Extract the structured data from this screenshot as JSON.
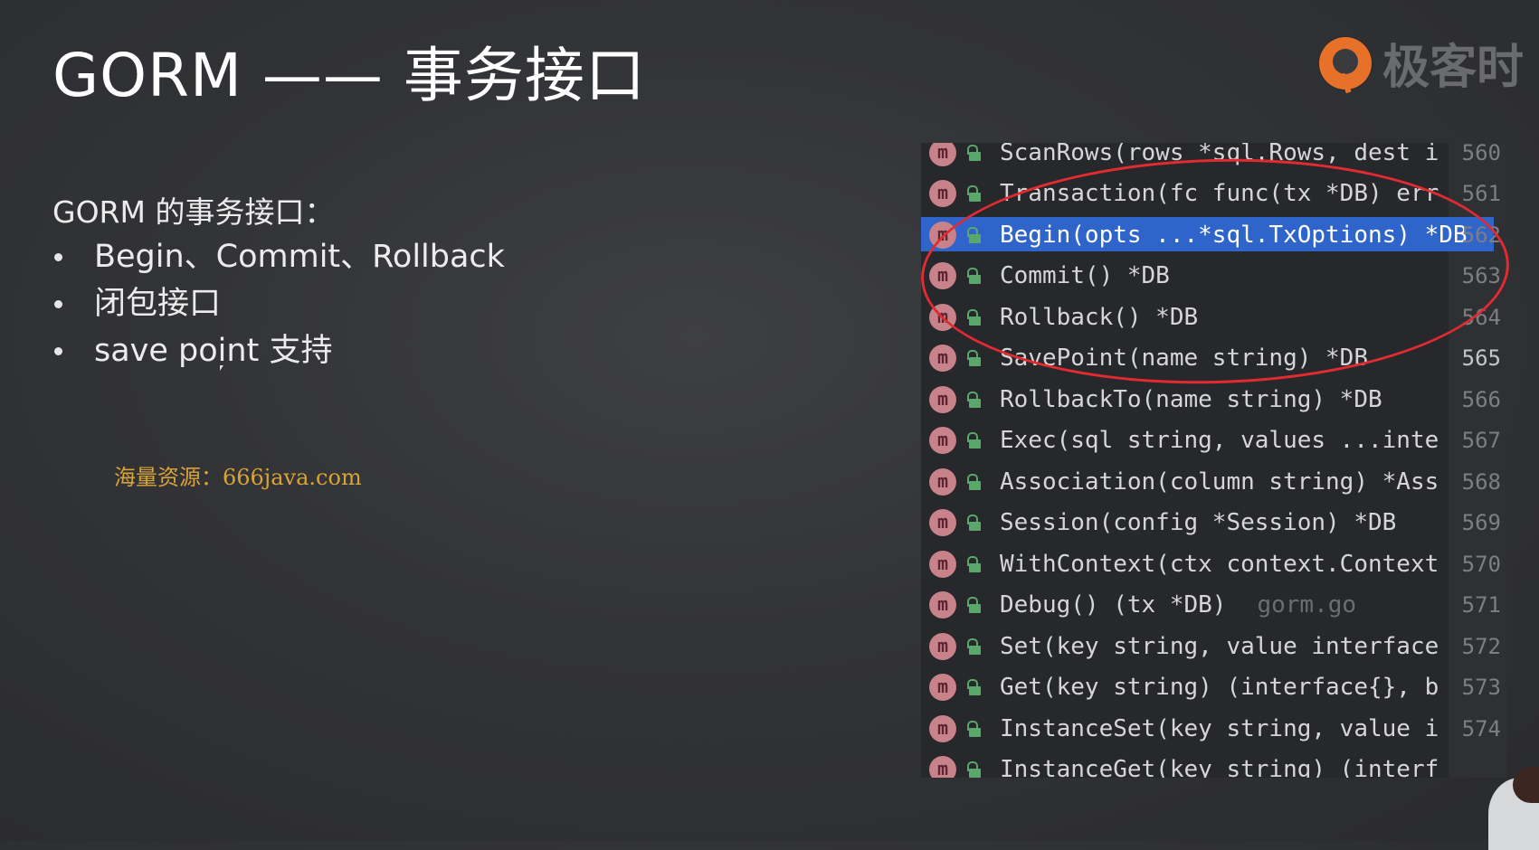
{
  "slide": {
    "title": "GORM —— 事务接口",
    "intro": "GORM 的事务接口：",
    "bullets": [
      "Begin、Commit、Rollback",
      "闭包接口",
      "save point 支持"
    ],
    "watermark": "海量资源：666java.com"
  },
  "logo": {
    "icon": "geek-time-logo-icon",
    "text": "极客时",
    "color": "#e8712a"
  },
  "completion": {
    "method_icon_letter": "m",
    "items": [
      {
        "signature": "ScanRows(rows *sql.Rows, dest i",
        "line": "560"
      },
      {
        "signature": "Transaction(fc func(tx *DB) err",
        "line": "561"
      },
      {
        "signature": "Begin(opts ...*sql.TxOptions) *DB",
        "line": "562",
        "selected": true
      },
      {
        "signature": "Commit() *DB",
        "line": "563"
      },
      {
        "signature": "Rollback() *DB",
        "line": "564"
      },
      {
        "signature": "SavePoint(name string) *DB",
        "line": "565"
      },
      {
        "signature": "RollbackTo(name string) *DB",
        "line": "566"
      },
      {
        "signature": "Exec(sql string, values ...inte",
        "line": "567"
      },
      {
        "signature": "Association(column string) *Ass",
        "line": "568"
      },
      {
        "signature": "Session(config *Session) *DB",
        "line": "569"
      },
      {
        "signature": "WithContext(ctx context.Context",
        "line": "570"
      },
      {
        "signature": "Debug() (tx *DB)",
        "file": "gorm.go",
        "line": "571"
      },
      {
        "signature": "Set(key string, value interface",
        "line": "572"
      },
      {
        "signature": "Get(key string) (interface{}, b",
        "line": "573"
      },
      {
        "signature": "InstanceSet(key string, value i",
        "line": "574"
      },
      {
        "signature": "InstanceGet(key string) (interf",
        "line": ""
      }
    ]
  },
  "colors": {
    "selection": "#2f65ca",
    "annotation_circle": "#e12b31",
    "method_icon": "#c7828a",
    "public_icon": "#59a869",
    "watermark": "#d9a437"
  }
}
